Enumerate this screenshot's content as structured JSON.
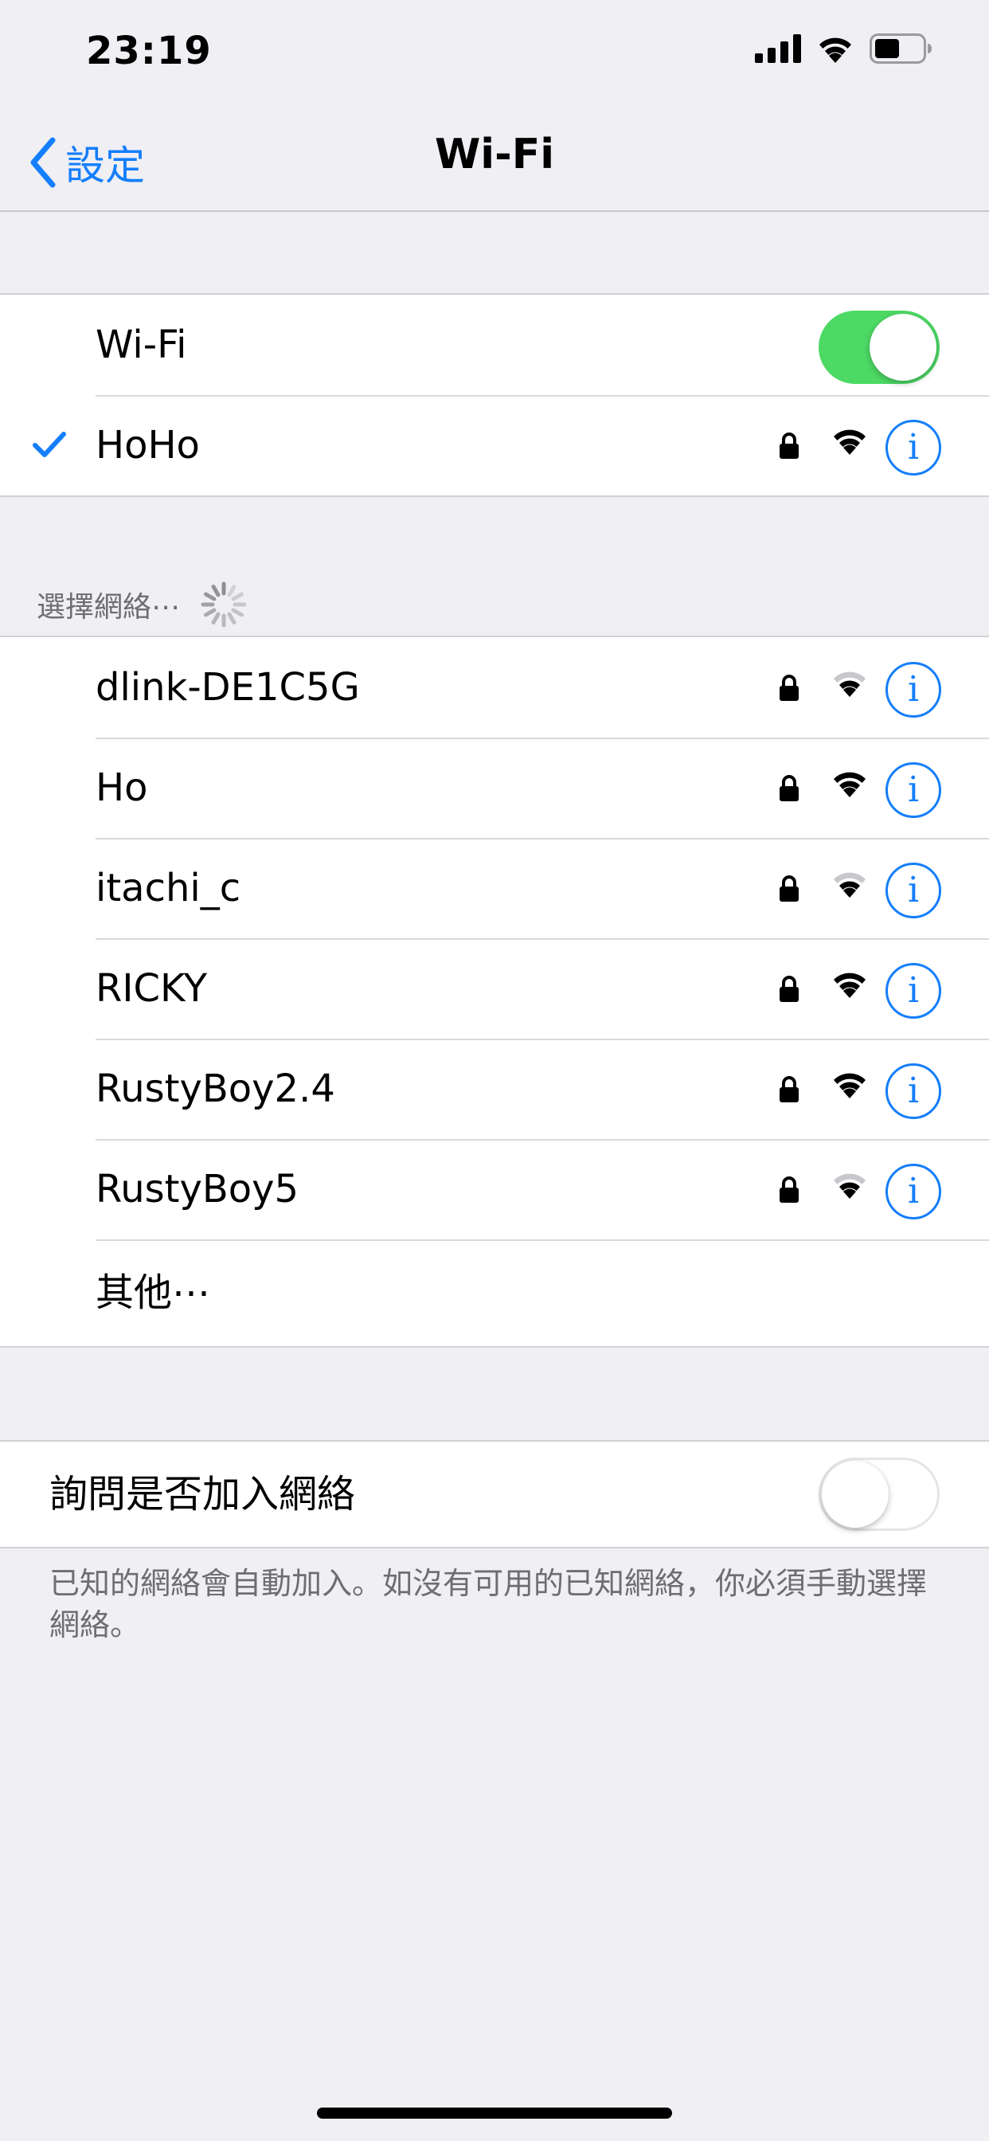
{
  "status_bar": {
    "time": "23:19",
    "icons": [
      "cellular-signal-icon",
      "wifi-icon",
      "battery-icon"
    ]
  },
  "nav": {
    "back_label": "設定",
    "title": "Wi-Fi"
  },
  "wifi_section": {
    "wifi_label": "Wi-Fi",
    "wifi_enabled": true,
    "connected_network": {
      "name": "HoHo",
      "secured": true,
      "signal": "strong"
    }
  },
  "networks_section": {
    "header": "選擇網絡⋯",
    "networks": [
      {
        "name": "dlink-DE1C5G",
        "secured": true,
        "signal": "weak"
      },
      {
        "name": "Ho",
        "secured": true,
        "signal": "strong"
      },
      {
        "name": "itachi_c",
        "secured": true,
        "signal": "weak"
      },
      {
        "name": "RICKY",
        "secured": true,
        "signal": "strong"
      },
      {
        "name": "RustyBoy2.4",
        "secured": true,
        "signal": "strong"
      },
      {
        "name": "RustyBoy5",
        "secured": true,
        "signal": "weak"
      }
    ],
    "other_label": "其他⋯"
  },
  "ask_section": {
    "label": "詢問是否加入網絡",
    "enabled": false,
    "footer": "已知的網絡會自動加入。如沒有可用的已知網絡，你必須手動選擇網絡。"
  },
  "colors": {
    "accent": "#147efb",
    "toggle_on": "#4cd964",
    "background": "#efeff4",
    "weak_signal_bar": "#c7c7cc"
  }
}
